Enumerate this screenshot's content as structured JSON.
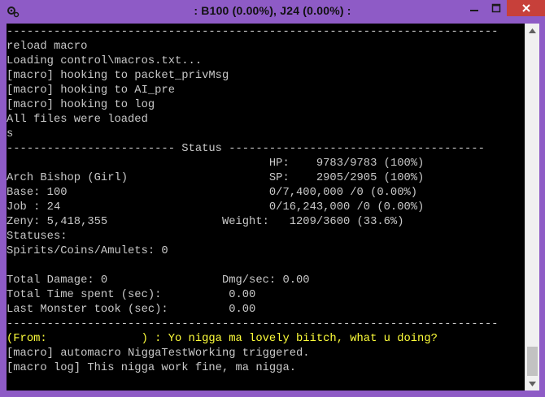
{
  "window": {
    "title": "       : B100 (0.00%), J24 (0.00%) :",
    "icon": "gear-icon",
    "accent_color": "#8e5bc6",
    "close_color": "#c7403a"
  },
  "console": {
    "text_color": "#c8c8c8",
    "highlight_color": "#ffff3a",
    "lines": [
      {
        "text": "-------------------------------------------------------------------------",
        "color": "gray"
      },
      {
        "text": "reload macro",
        "color": "gray"
      },
      {
        "text": "Loading control\\macros.txt...",
        "color": "gray"
      },
      {
        "text": "[macro] hooking to packet_privMsg",
        "color": "gray"
      },
      {
        "text": "[macro] hooking to AI_pre",
        "color": "gray"
      },
      {
        "text": "[macro] hooking to log",
        "color": "gray"
      },
      {
        "text": "All files were loaded",
        "color": "gray"
      },
      {
        "text": "s",
        "color": "gray"
      },
      {
        "text": "------------------------- Status --------------------------------------",
        "color": "gray"
      },
      {
        "text": "                                       HP:    9783/9783 (100%)",
        "color": "gray"
      },
      {
        "text": "Arch Bishop (Girl)                     SP:    2905/2905 (100%)",
        "color": "gray"
      },
      {
        "text": "Base: 100                              0/7,400,000 /0 (0.00%)",
        "color": "gray"
      },
      {
        "text": "Job : 24                               0/16,243,000 /0 (0.00%)",
        "color": "gray"
      },
      {
        "text": "Zeny: 5,418,355                 Weight:   1209/3600 (33.6%)",
        "color": "gray"
      },
      {
        "text": "Statuses:",
        "color": "gray"
      },
      {
        "text": "Spirits/Coins/Amulets: 0",
        "color": "gray"
      },
      {
        "text": "",
        "color": "gray"
      },
      {
        "text": "Total Damage: 0                 Dmg/sec: 0.00",
        "color": "gray"
      },
      {
        "text": "Total Time spent (sec):          0.00",
        "color": "gray"
      },
      {
        "text": "Last Monster took (sec):         0.00",
        "color": "gray"
      },
      {
        "text": "-------------------------------------------------------------------------",
        "color": "gray"
      },
      {
        "text": "(From:              ) : Yo nigga ma lovely biitch, what u doing?",
        "color": "yellow"
      },
      {
        "text": "[macro] automacro NiggaTestWorking triggered.",
        "color": "gray"
      },
      {
        "text": "[macro log] This nigga work fine, ma nigga.",
        "color": "gray"
      }
    ]
  }
}
